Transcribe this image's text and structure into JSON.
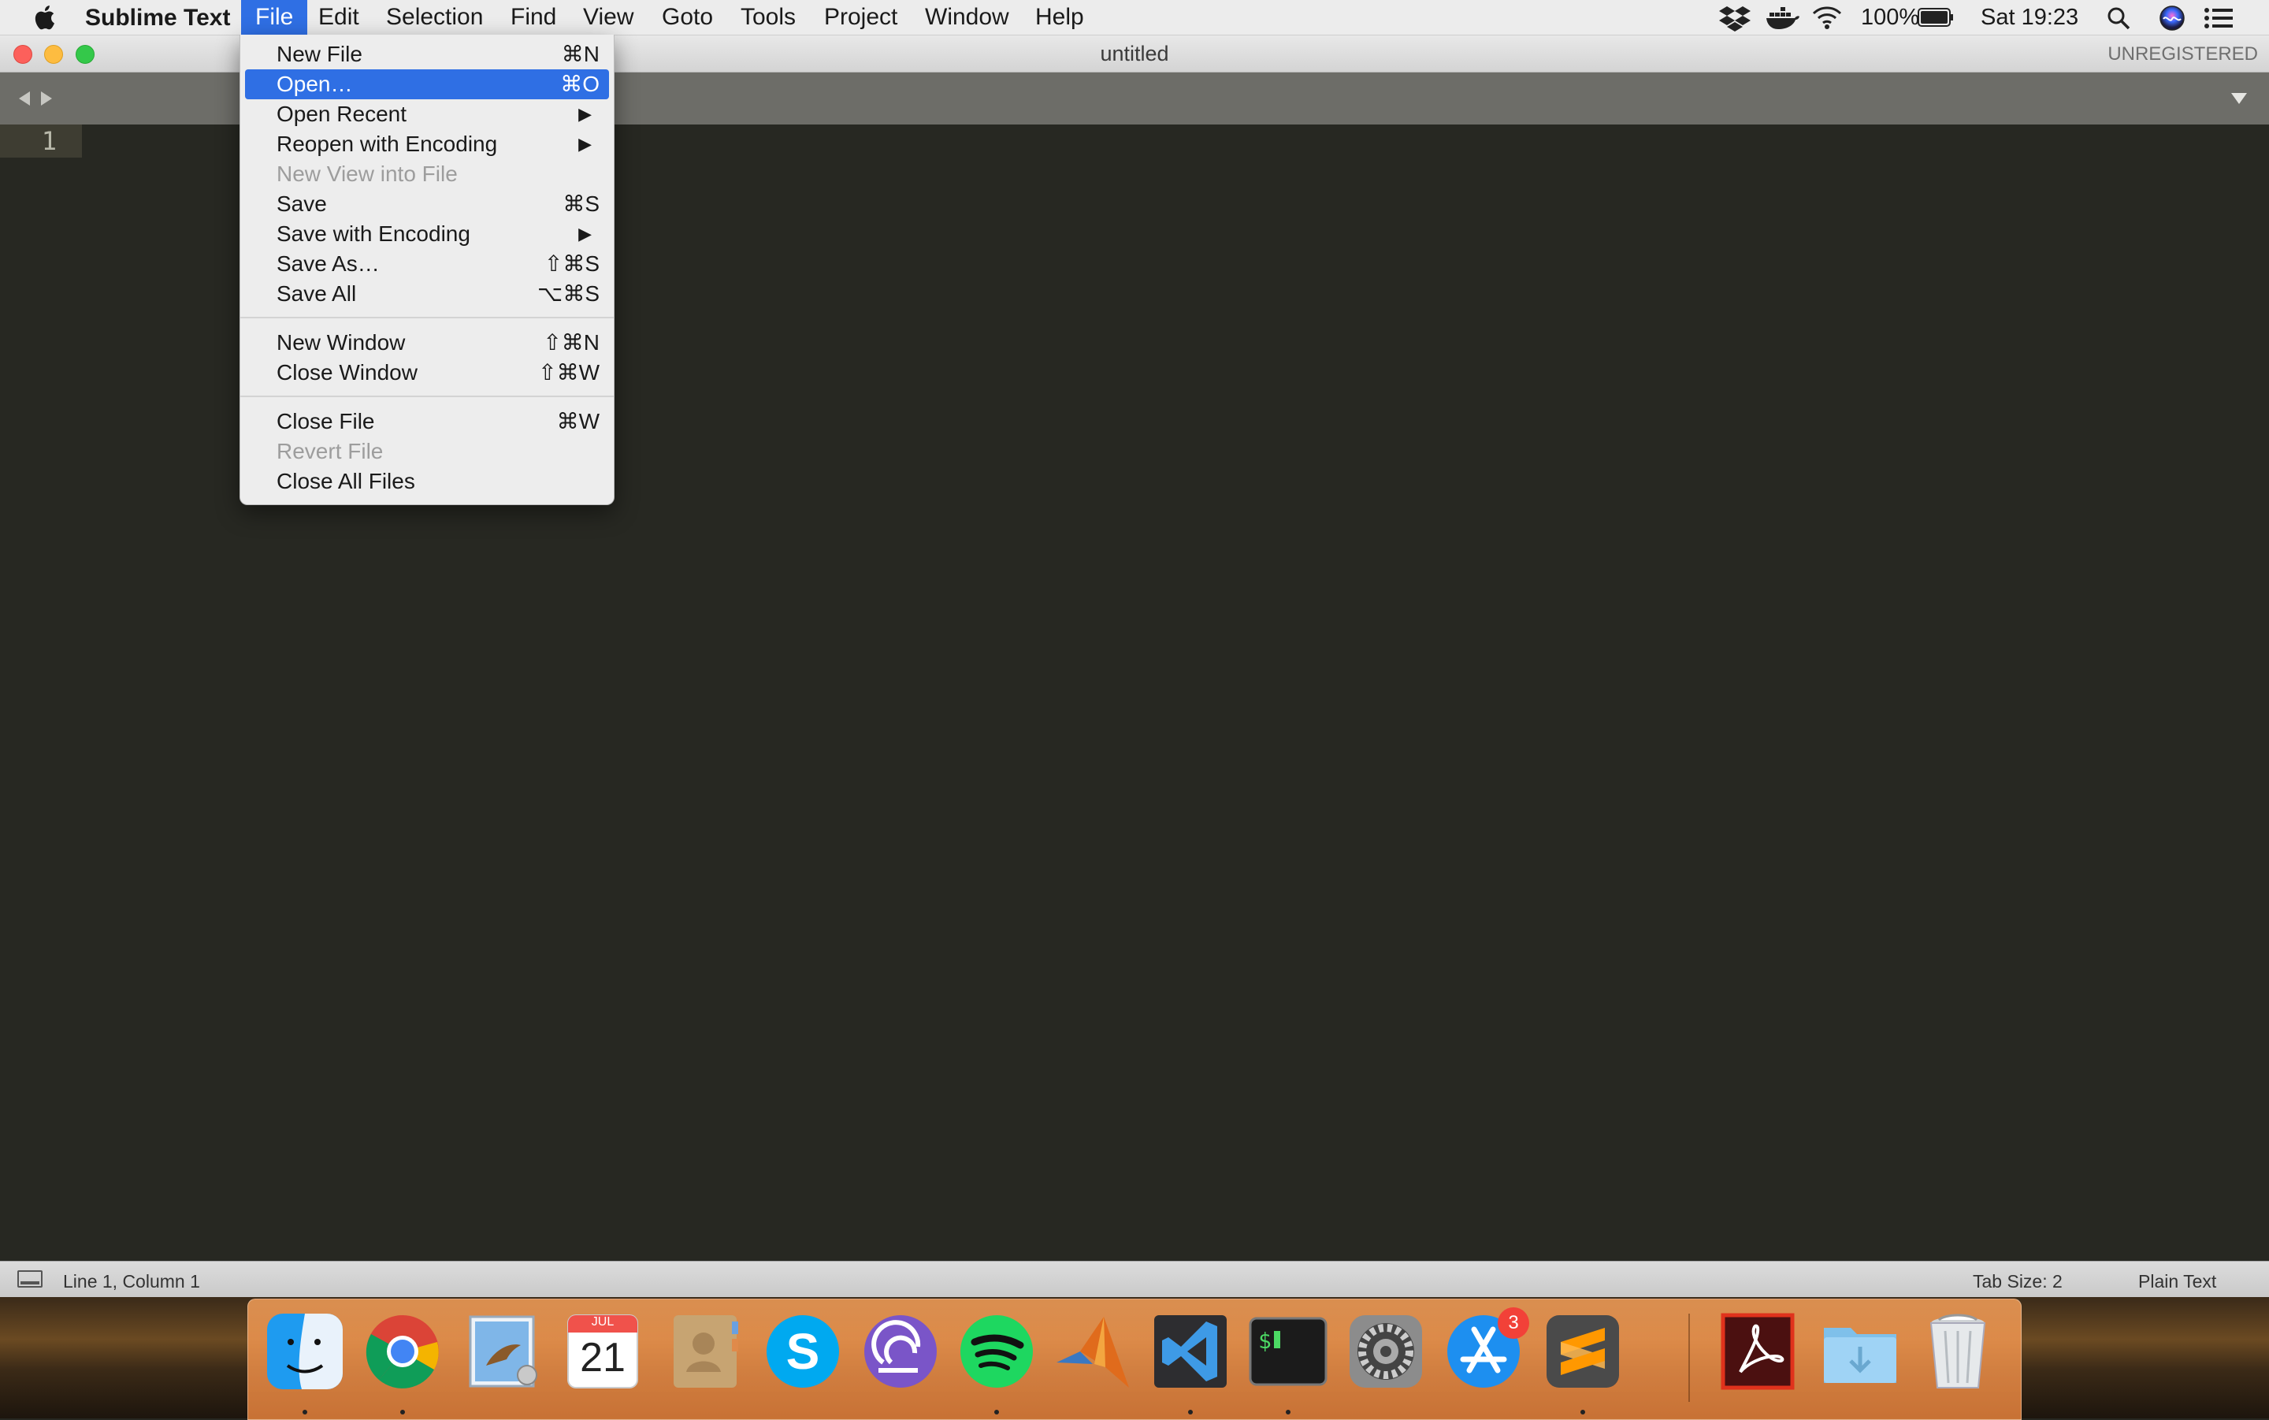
{
  "menubar": {
    "app_name": "Sublime Text",
    "items": [
      "File",
      "Edit",
      "Selection",
      "Find",
      "View",
      "Goto",
      "Tools",
      "Project",
      "Window",
      "Help"
    ],
    "active_item": "File",
    "battery": "100%",
    "clock": "Sat 19:23",
    "icons": [
      "apple-icon",
      "dropbox-icon",
      "docker-icon",
      "wifi-icon",
      "battery-icon",
      "spotlight-search-icon",
      "siri-icon",
      "notification-center-icon"
    ]
  },
  "window": {
    "title": "untitled",
    "license": "UNREGISTERED"
  },
  "editor": {
    "line_number": "1"
  },
  "statusbar": {
    "position": "Line 1, Column 1",
    "tab_size": "Tab Size: 2",
    "syntax": "Plain Text"
  },
  "file_menu": {
    "items": [
      {
        "label": "New File",
        "shortcut": "⌘N"
      },
      {
        "label": "Open…",
        "shortcut": "⌘O",
        "highlighted": true
      },
      {
        "label": "Open Recent",
        "submenu": true
      },
      {
        "label": "Reopen with Encoding",
        "submenu": true
      },
      {
        "label": "New View into File",
        "disabled": true
      },
      {
        "label": "Save",
        "shortcut": "⌘S"
      },
      {
        "label": "Save with Encoding",
        "submenu": true
      },
      {
        "label": "Save As…",
        "shortcut": "⇧⌘S"
      },
      {
        "label": "Save All",
        "shortcut": "⌥⌘S"
      },
      {
        "label": "New Window",
        "shortcut": "⇧⌘N"
      },
      {
        "label": "Close Window",
        "shortcut": "⇧⌘W"
      },
      {
        "label": "Close File",
        "shortcut": "⌘W"
      },
      {
        "label": "Revert File",
        "disabled": true
      },
      {
        "label": "Close All Files"
      }
    ],
    "submenu_arrow": "▶"
  },
  "dock": {
    "calendar_month": "JUL",
    "calendar_day": "21",
    "appstore_badge": "3",
    "terminal_prompt": "$",
    "apps": [
      "finder-icon",
      "chrome-icon",
      "mail-icon",
      "calendar-icon",
      "contacts-icon",
      "skype-icon",
      "bittorrent-icon",
      "spotify-icon",
      "matlab-icon",
      "vscode-icon",
      "terminal-icon",
      "system-preferences-icon",
      "app-store-icon",
      "sublime-text-icon",
      "acrobat-icon",
      "downloads-folder-icon",
      "trash-icon"
    ]
  },
  "colors": {
    "menu_highlight": "#2f6fe4",
    "editor_bg": "#272822",
    "gutter_active": "#3e3d32"
  }
}
